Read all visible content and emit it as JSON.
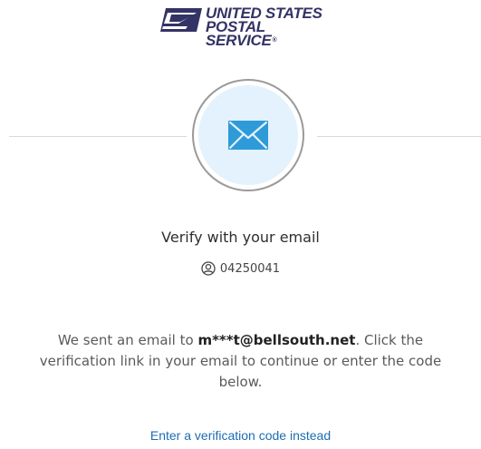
{
  "brand": {
    "line1": "UNITED STATES",
    "line2": "POSTAL SERVICE",
    "registered_mark": "®",
    "eagle_icon": "usps-eagle-icon",
    "color": "#333366"
  },
  "verify": {
    "icon": "envelope-icon",
    "title": "Verify with your email",
    "user_icon": "user-circle-icon",
    "user_id": "04250041",
    "message_prefix": "We sent an email to ",
    "email": "m***t@bellsouth.net",
    "message_suffix": ". Click the verification link in your email to continue or enter the code below.",
    "code_link": "Enter a verification code instead"
  },
  "colors": {
    "accent": "#1c6cb3",
    "circle_fill": "#e3f2fc",
    "envelope": "#2f9ad8"
  }
}
